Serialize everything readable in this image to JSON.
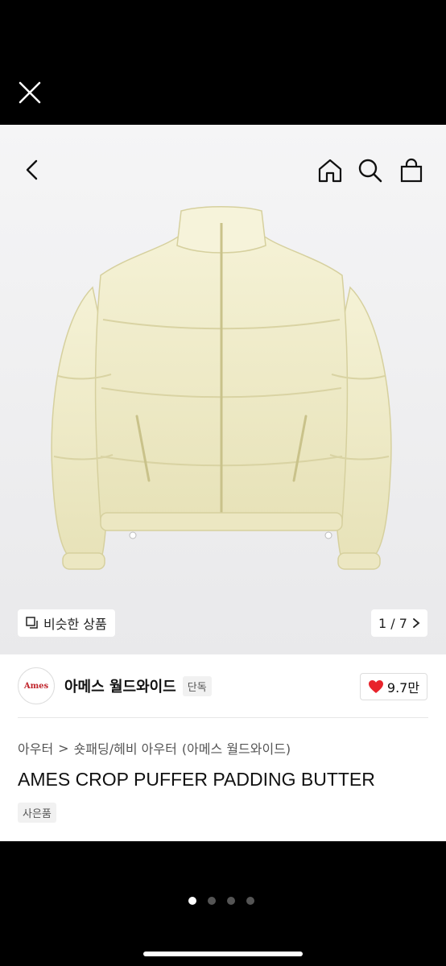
{
  "nav": {
    "close_icon": "close-icon",
    "back_icon": "chevron-left-icon",
    "home_icon": "home-icon",
    "search_icon": "search-icon",
    "bag_icon": "shopping-bag-icon"
  },
  "gallery": {
    "similar_label": "비슷한 상품",
    "counter": "1 / 7",
    "image_subject": "butter color cropped puffer jacket"
  },
  "brand": {
    "logo_text": "Ames",
    "name": "아메스 월드와이드",
    "badge": "단독"
  },
  "likes": {
    "count": "9.7만"
  },
  "breadcrumb": {
    "level1": "아우터",
    "separator": ">",
    "level2": "숏패딩/헤비 아우터",
    "brand": "(아메스 월드와이드)"
  },
  "product": {
    "title": "AMES CROP PUFFER PADDING BUTTER",
    "tag": "사은품"
  },
  "pager": {
    "total": 4,
    "active": 0
  },
  "colors": {
    "jacket": "#f1edc8",
    "heart": "#e8232b",
    "logo": "#c0262d"
  }
}
